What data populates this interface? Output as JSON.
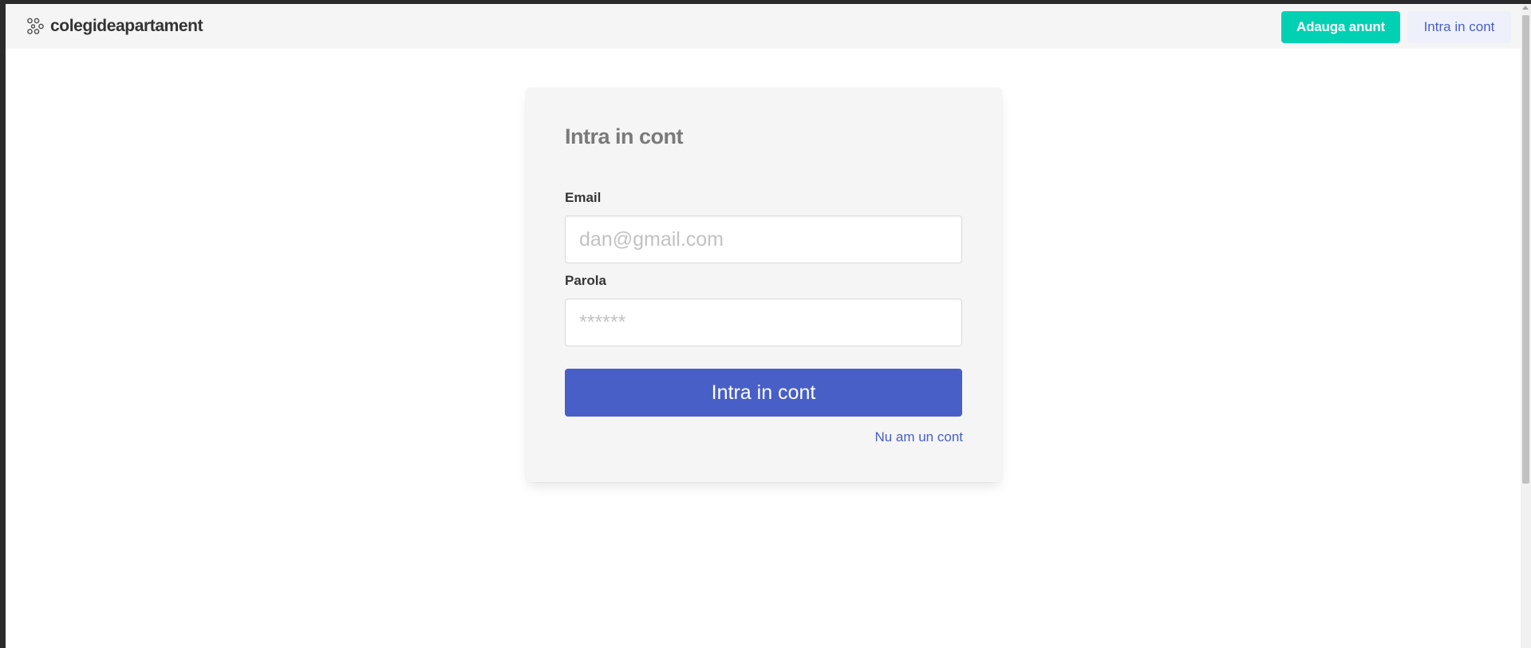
{
  "navbar": {
    "brand_name": "colegideapartament",
    "brand_icon": "brand-network-icon",
    "add_listing_label": "Adauga anunt",
    "login_label": "Intra in cont"
  },
  "login_card": {
    "title": "Intra in cont",
    "email_label": "Email",
    "email_placeholder": "dan@gmail.com",
    "email_value": "",
    "password_label": "Parola",
    "password_placeholder": "******",
    "password_value": "",
    "submit_label": "Intra in cont",
    "register_link": "Nu am un cont"
  },
  "colors": {
    "primary": "#485fc7",
    "accent": "#00d1b2",
    "navbar_bg": "#f5f5f5",
    "card_bg": "#f5f5f5"
  }
}
